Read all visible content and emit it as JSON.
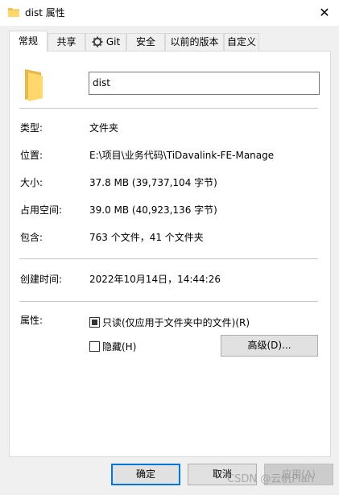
{
  "window": {
    "title": "dist 属性",
    "close_glyph": "✕",
    "accent_color": "#0078d7",
    "folder_color": "#f0c150"
  },
  "tabs": [
    {
      "label": "常规",
      "active": true
    },
    {
      "label": "共享",
      "active": false
    },
    {
      "label": "Git",
      "active": false,
      "icon": "git-icon"
    },
    {
      "label": "安全",
      "active": false
    },
    {
      "label": "以前的版本",
      "active": false
    },
    {
      "label": "自定义",
      "active": false
    }
  ],
  "general": {
    "name_value": "dist",
    "properties": [
      {
        "label": "类型:",
        "value": "文件夹"
      },
      {
        "label": "位置:",
        "value": "E:\\项目\\业务代码\\TiDavalink-FE-Manage"
      },
      {
        "label": "大小:",
        "value": "37.8 MB (39,737,104 字节)"
      },
      {
        "label": "占用空间:",
        "value": "39.0 MB (40,923,136 字节)"
      },
      {
        "label": "包含:",
        "value": "763 个文件，41 个文件夹"
      }
    ],
    "created_label": "创建时间:",
    "created_value": "2022年10月14日，14:44:26",
    "attributes_label": "属性:",
    "readonly_label": "只读(仅应用于文件夹中的文件)(R)",
    "hidden_label": "隐藏(H)",
    "advanced_button": "高级(D)..."
  },
  "footer": {
    "ok": "确定",
    "cancel": "取消",
    "apply": "应用(A)"
  },
  "watermark": "CSDN @云帆Plan"
}
